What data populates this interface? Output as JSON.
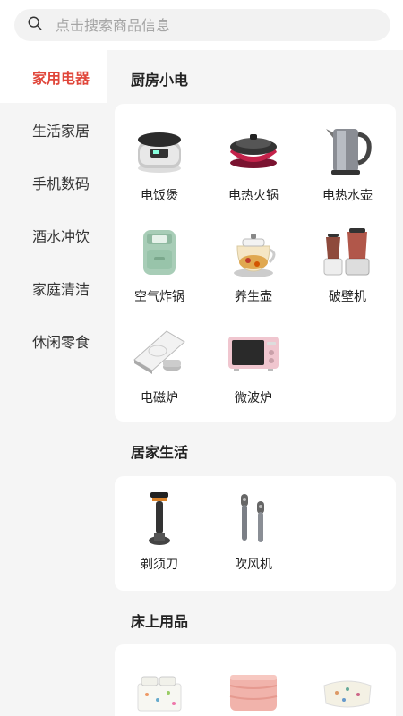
{
  "search": {
    "placeholder": "点击搜索商品信息"
  },
  "sidebar": {
    "items": [
      {
        "label": "家用电器"
      },
      {
        "label": "生活家居"
      },
      {
        "label": "手机数码"
      },
      {
        "label": "酒水冲饮"
      },
      {
        "label": "家庭清洁"
      },
      {
        "label": "休闲零食"
      }
    ]
  },
  "sections": [
    {
      "title": "厨房小电",
      "products": [
        {
          "label": "电饭煲",
          "icon": "rice-cooker-icon"
        },
        {
          "label": "电热火锅",
          "icon": "hot-pot-icon"
        },
        {
          "label": "电热水壶",
          "icon": "electric-kettle-icon"
        },
        {
          "label": "空气炸锅",
          "icon": "air-fryer-icon"
        },
        {
          "label": "养生壶",
          "icon": "health-pot-icon"
        },
        {
          "label": "破壁机",
          "icon": "blender-icon"
        },
        {
          "label": "电磁炉",
          "icon": "induction-cooker-icon"
        },
        {
          "label": "微波炉",
          "icon": "microwave-icon"
        }
      ]
    },
    {
      "title": "居家生活",
      "products": [
        {
          "label": "剃须刀",
          "icon": "razor-icon"
        },
        {
          "label": "吹风机",
          "icon": "hair-dryer-icon"
        }
      ]
    },
    {
      "title": "床上用品",
      "products": [
        {
          "label": "",
          "icon": "bedding-set-icon"
        },
        {
          "label": "",
          "icon": "quilt-icon"
        },
        {
          "label": "",
          "icon": "pillow-icon"
        }
      ]
    }
  ],
  "colors": {
    "accent": "#e0463a",
    "background": "#f5f5f5",
    "card": "#ffffff"
  }
}
